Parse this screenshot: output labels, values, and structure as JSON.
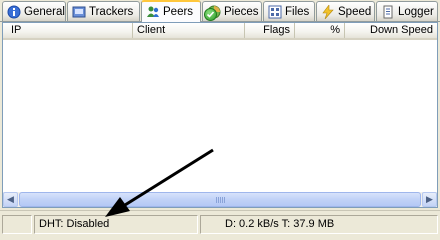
{
  "tabs": [
    {
      "label": "General",
      "icon": "info-icon",
      "active": false
    },
    {
      "label": "Trackers",
      "icon": "trackers-icon",
      "active": false
    },
    {
      "label": "Peers",
      "icon": "peers-icon",
      "active": true
    },
    {
      "label": "Pieces",
      "icon": "pieces-icon",
      "active": false
    },
    {
      "label": "Files",
      "icon": "files-icon",
      "active": false
    },
    {
      "label": "Speed",
      "icon": "speed-icon",
      "active": false
    },
    {
      "label": "Logger",
      "icon": "logger-icon",
      "active": false
    }
  ],
  "columns": [
    "IP",
    "Client",
    "Flags",
    "%",
    "Down Speed"
  ],
  "status": {
    "dht": "DHT: Disabled",
    "transfer": "D: 0.2 kB/s T: 37.9 MB",
    "network_icon": "check-icon"
  },
  "colors": {
    "active_tab_accent": "#ffc73c",
    "scrollbar": "#c1d2f7",
    "status_ok": "#2c9a28"
  }
}
